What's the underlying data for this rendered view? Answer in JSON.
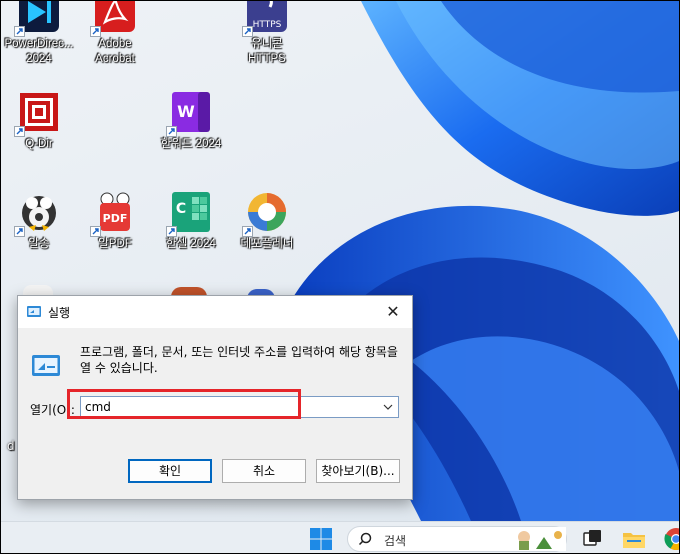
{
  "desktop": {
    "icons": [
      {
        "name": "PowerDirector 2024",
        "label": "PowerDirec...\n2024"
      },
      {
        "name": "Adobe Acrobat",
        "label": "Adobe\nAcrobat"
      },
      {
        "name": "유니콘 HTTPS",
        "label": "유니콘\nHTTPS"
      },
      {
        "name": "Q-Dir",
        "label": "Q-Dir"
      },
      {
        "name": "한워드 2024",
        "label": "한워드 2024"
      },
      {
        "name": "알송",
        "label": "알송"
      },
      {
        "name": "알PDF",
        "label": "알PDF"
      },
      {
        "name": "한셀 2024",
        "label": "한셀 2024"
      },
      {
        "name": "데포플레너",
        "label": "데포플레너"
      }
    ],
    "partial_label": "d"
  },
  "run_dialog": {
    "title": "실행",
    "description": "프로그램, 폴더, 문서, 또는 인터넷 주소를 입력하여 해당 항목을 열 수 있습니다.",
    "open_label": "열기(O):",
    "open_value": "cmd",
    "buttons": {
      "ok": "확인",
      "cancel": "취소",
      "browse": "찾아보기(B)..."
    },
    "close_glyph": "✕"
  },
  "taskbar": {
    "search_placeholder": "검색"
  },
  "colors": {
    "highlight": "#e5252a",
    "accent": "#0067c0",
    "wallpaper_blue": "#1f6fe8"
  }
}
